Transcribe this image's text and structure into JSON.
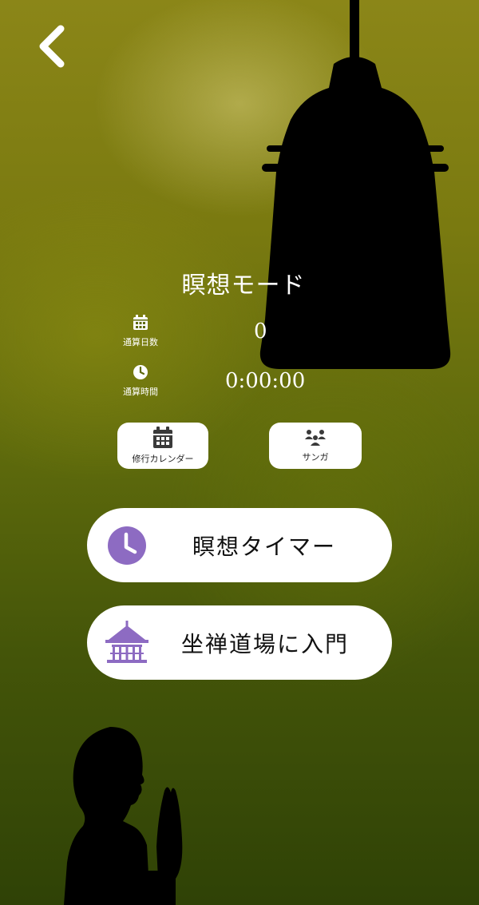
{
  "header": {
    "back_icon": "chevron-left-icon"
  },
  "main": {
    "title": "瞑想モード",
    "stats": {
      "days_label": "通算日数",
      "days_value": "0",
      "days_icon": "calendar-icon",
      "time_label": "通算時間",
      "time_value": "0:00:00",
      "time_icon": "clock-icon"
    },
    "shortcuts": {
      "calendar_label": "修行カレンダー",
      "calendar_icon": "calendar-icon",
      "sanga_label": "サンガ",
      "sanga_icon": "group-icon"
    },
    "actions": {
      "timer_label": "瞑想タイマー",
      "timer_icon": "clock-icon",
      "dojo_label": "坐禅道場に入門",
      "dojo_icon": "temple-icon"
    }
  },
  "colors": {
    "accent": "#8d6bc2",
    "button_bg": "#ffffff",
    "text_light": "#ffffff"
  }
}
